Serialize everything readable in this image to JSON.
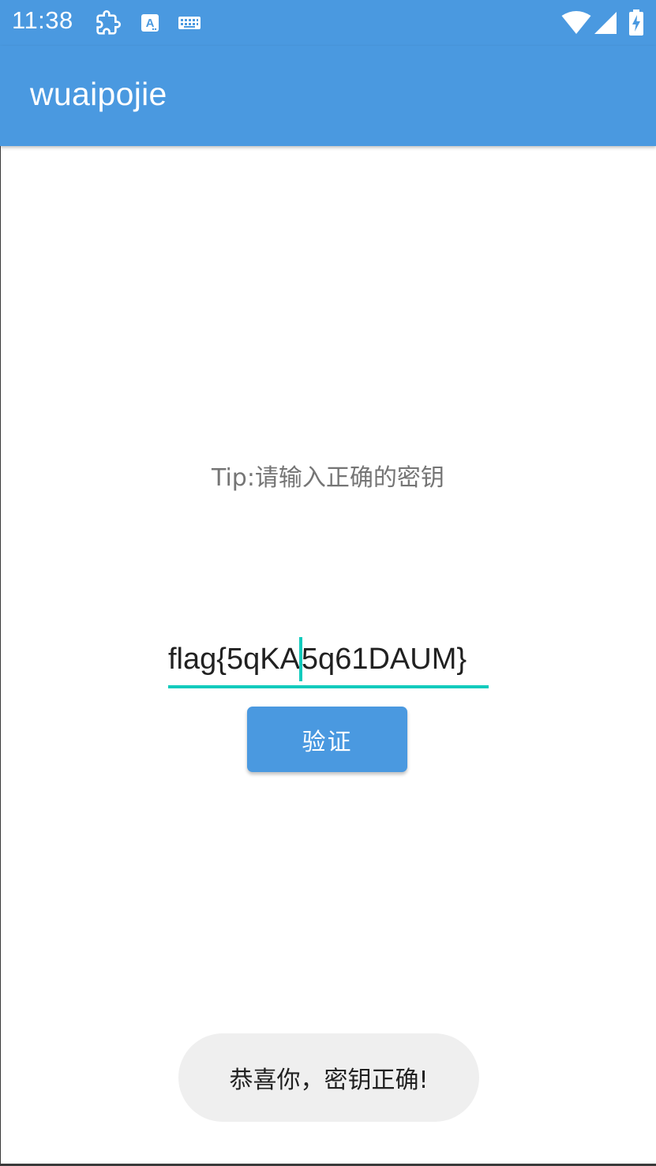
{
  "status_bar": {
    "time": "11:38",
    "icons": [
      "puzzle-icon",
      "a-badge-icon",
      "keyboard-icon",
      "wifi-icon",
      "cellular-signal-icon",
      "battery-charging-icon"
    ],
    "a_badge_letter": "A"
  },
  "app_bar": {
    "title": "wuaipojie"
  },
  "main": {
    "tip": "Tip:请输入正确的密钥",
    "input": {
      "value_before_cursor": "flag{5qKA",
      "value_after_cursor": "5q61DAUM}"
    },
    "verify_button_label": "验证"
  },
  "toast": {
    "message": "恭喜你，密钥正确!"
  },
  "colors": {
    "primary": "#4a99e0",
    "accent": "#12cbbd",
    "toast_bg": "#efefef",
    "tip_text": "#757575"
  }
}
